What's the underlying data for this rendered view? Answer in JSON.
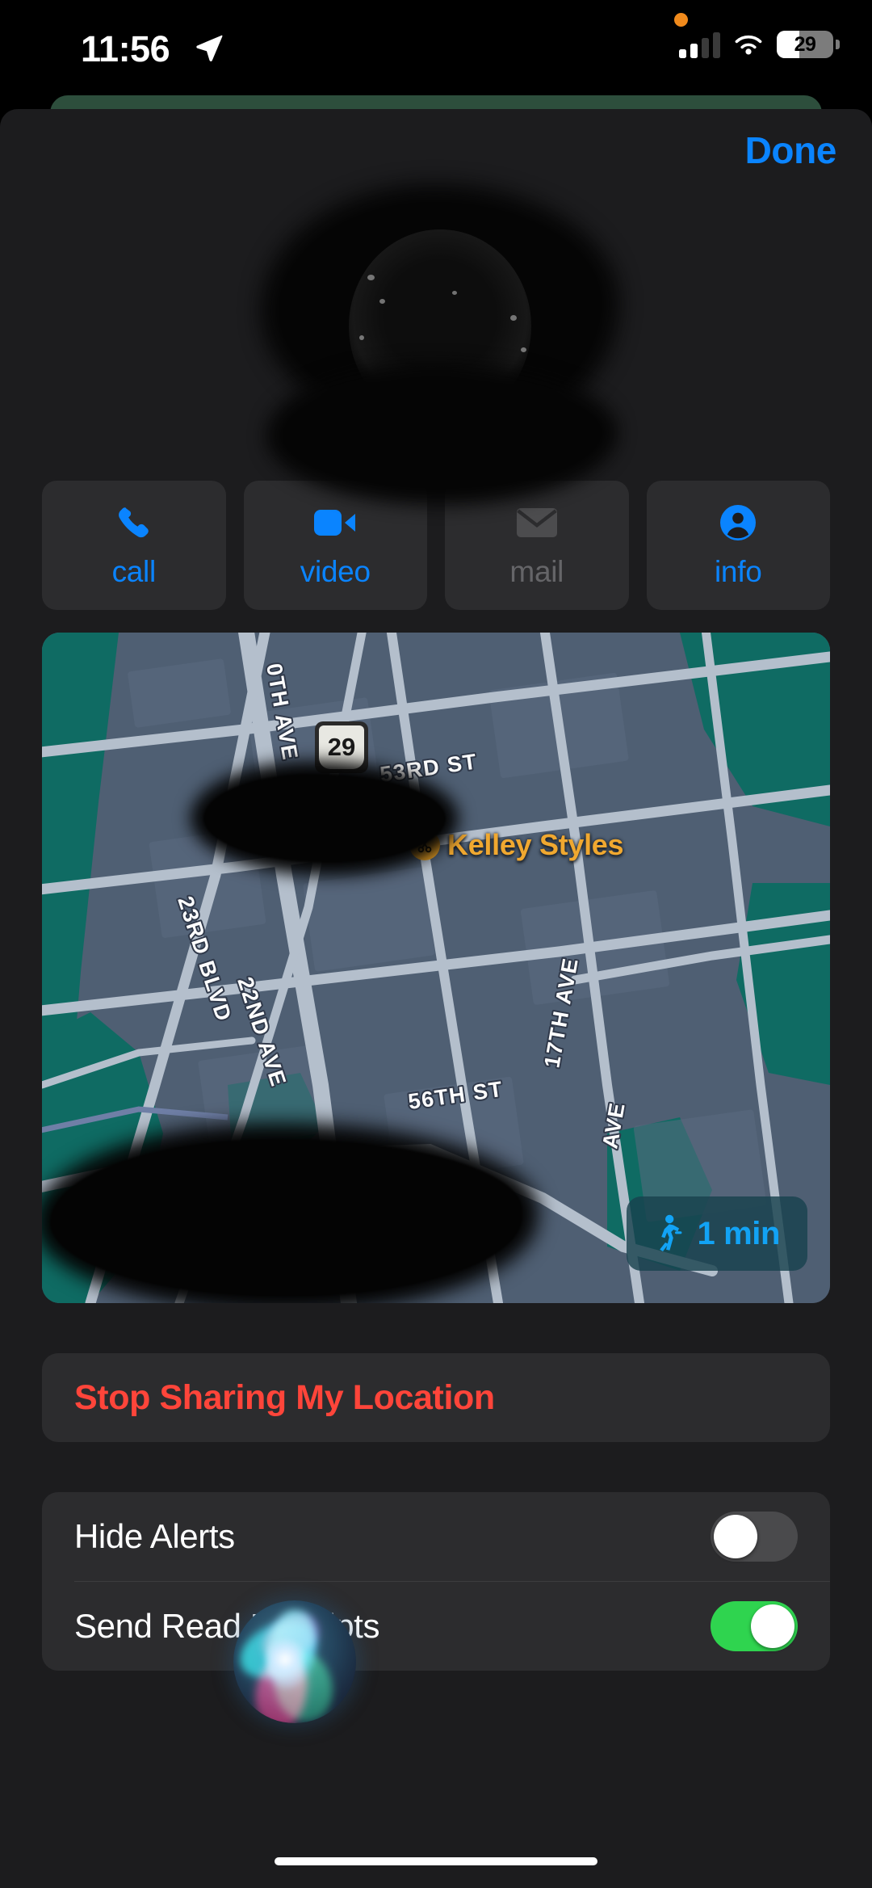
{
  "status_bar": {
    "time": "11:56",
    "location_icon": "location-arrow-icon",
    "privacy_indicator_color": "#F08A1C",
    "cellular_bars_filled": 2,
    "cellular_bars_total": 4,
    "wifi_icon": "wifi-icon",
    "battery_percent": "29",
    "battery_level_fraction": 0.29
  },
  "sheet": {
    "done_label": "Done",
    "accent_color": "#0A84FF",
    "background_color": "#1C1C1E"
  },
  "identity": {
    "avatar_state": "redacted",
    "contact_name_state": "redacted"
  },
  "actions": [
    {
      "label": "call",
      "icon": "phone-icon",
      "enabled": true,
      "color": "#0A84FF"
    },
    {
      "label": "video",
      "icon": "video-camera-icon",
      "enabled": true,
      "color": "#0A84FF"
    },
    {
      "label": "mail",
      "icon": "envelope-icon",
      "enabled": false,
      "color": "#656568"
    },
    {
      "label": "info",
      "icon": "person-circle-icon",
      "enabled": true,
      "color": "#0A84FF"
    }
  ],
  "map": {
    "street_labels": [
      "0TH AVE",
      "53RD ST",
      "23RD BLVD",
      "22ND AVE",
      "56TH ST",
      "17TH AVE",
      "AVE"
    ],
    "highway_shield": "29",
    "poi": {
      "name": "Kelley Styles",
      "icon": "scissors-icon",
      "color": "#F0A830"
    },
    "travel_badge": {
      "icon": "walking-person-icon",
      "duration": "1 min",
      "color": "#12A3F5"
    },
    "address_state": "redacted",
    "caption_state": "redacted",
    "land_color": "#4A5A6E",
    "water_color": "#0F6B63",
    "road_color": "#A9B4C2"
  },
  "rows": {
    "stop_sharing_label": "Stop Sharing My Location",
    "destructive_color": "#FF453A",
    "toggles": [
      {
        "label": "Hide Alerts",
        "on": false
      },
      {
        "label": "Send Read Receipts",
        "on": true
      }
    ],
    "toggle_on_color": "#2FD44F"
  },
  "siri": {
    "state": "listening",
    "icon": "siri-orb-icon"
  },
  "home_indicator": "home-indicator"
}
